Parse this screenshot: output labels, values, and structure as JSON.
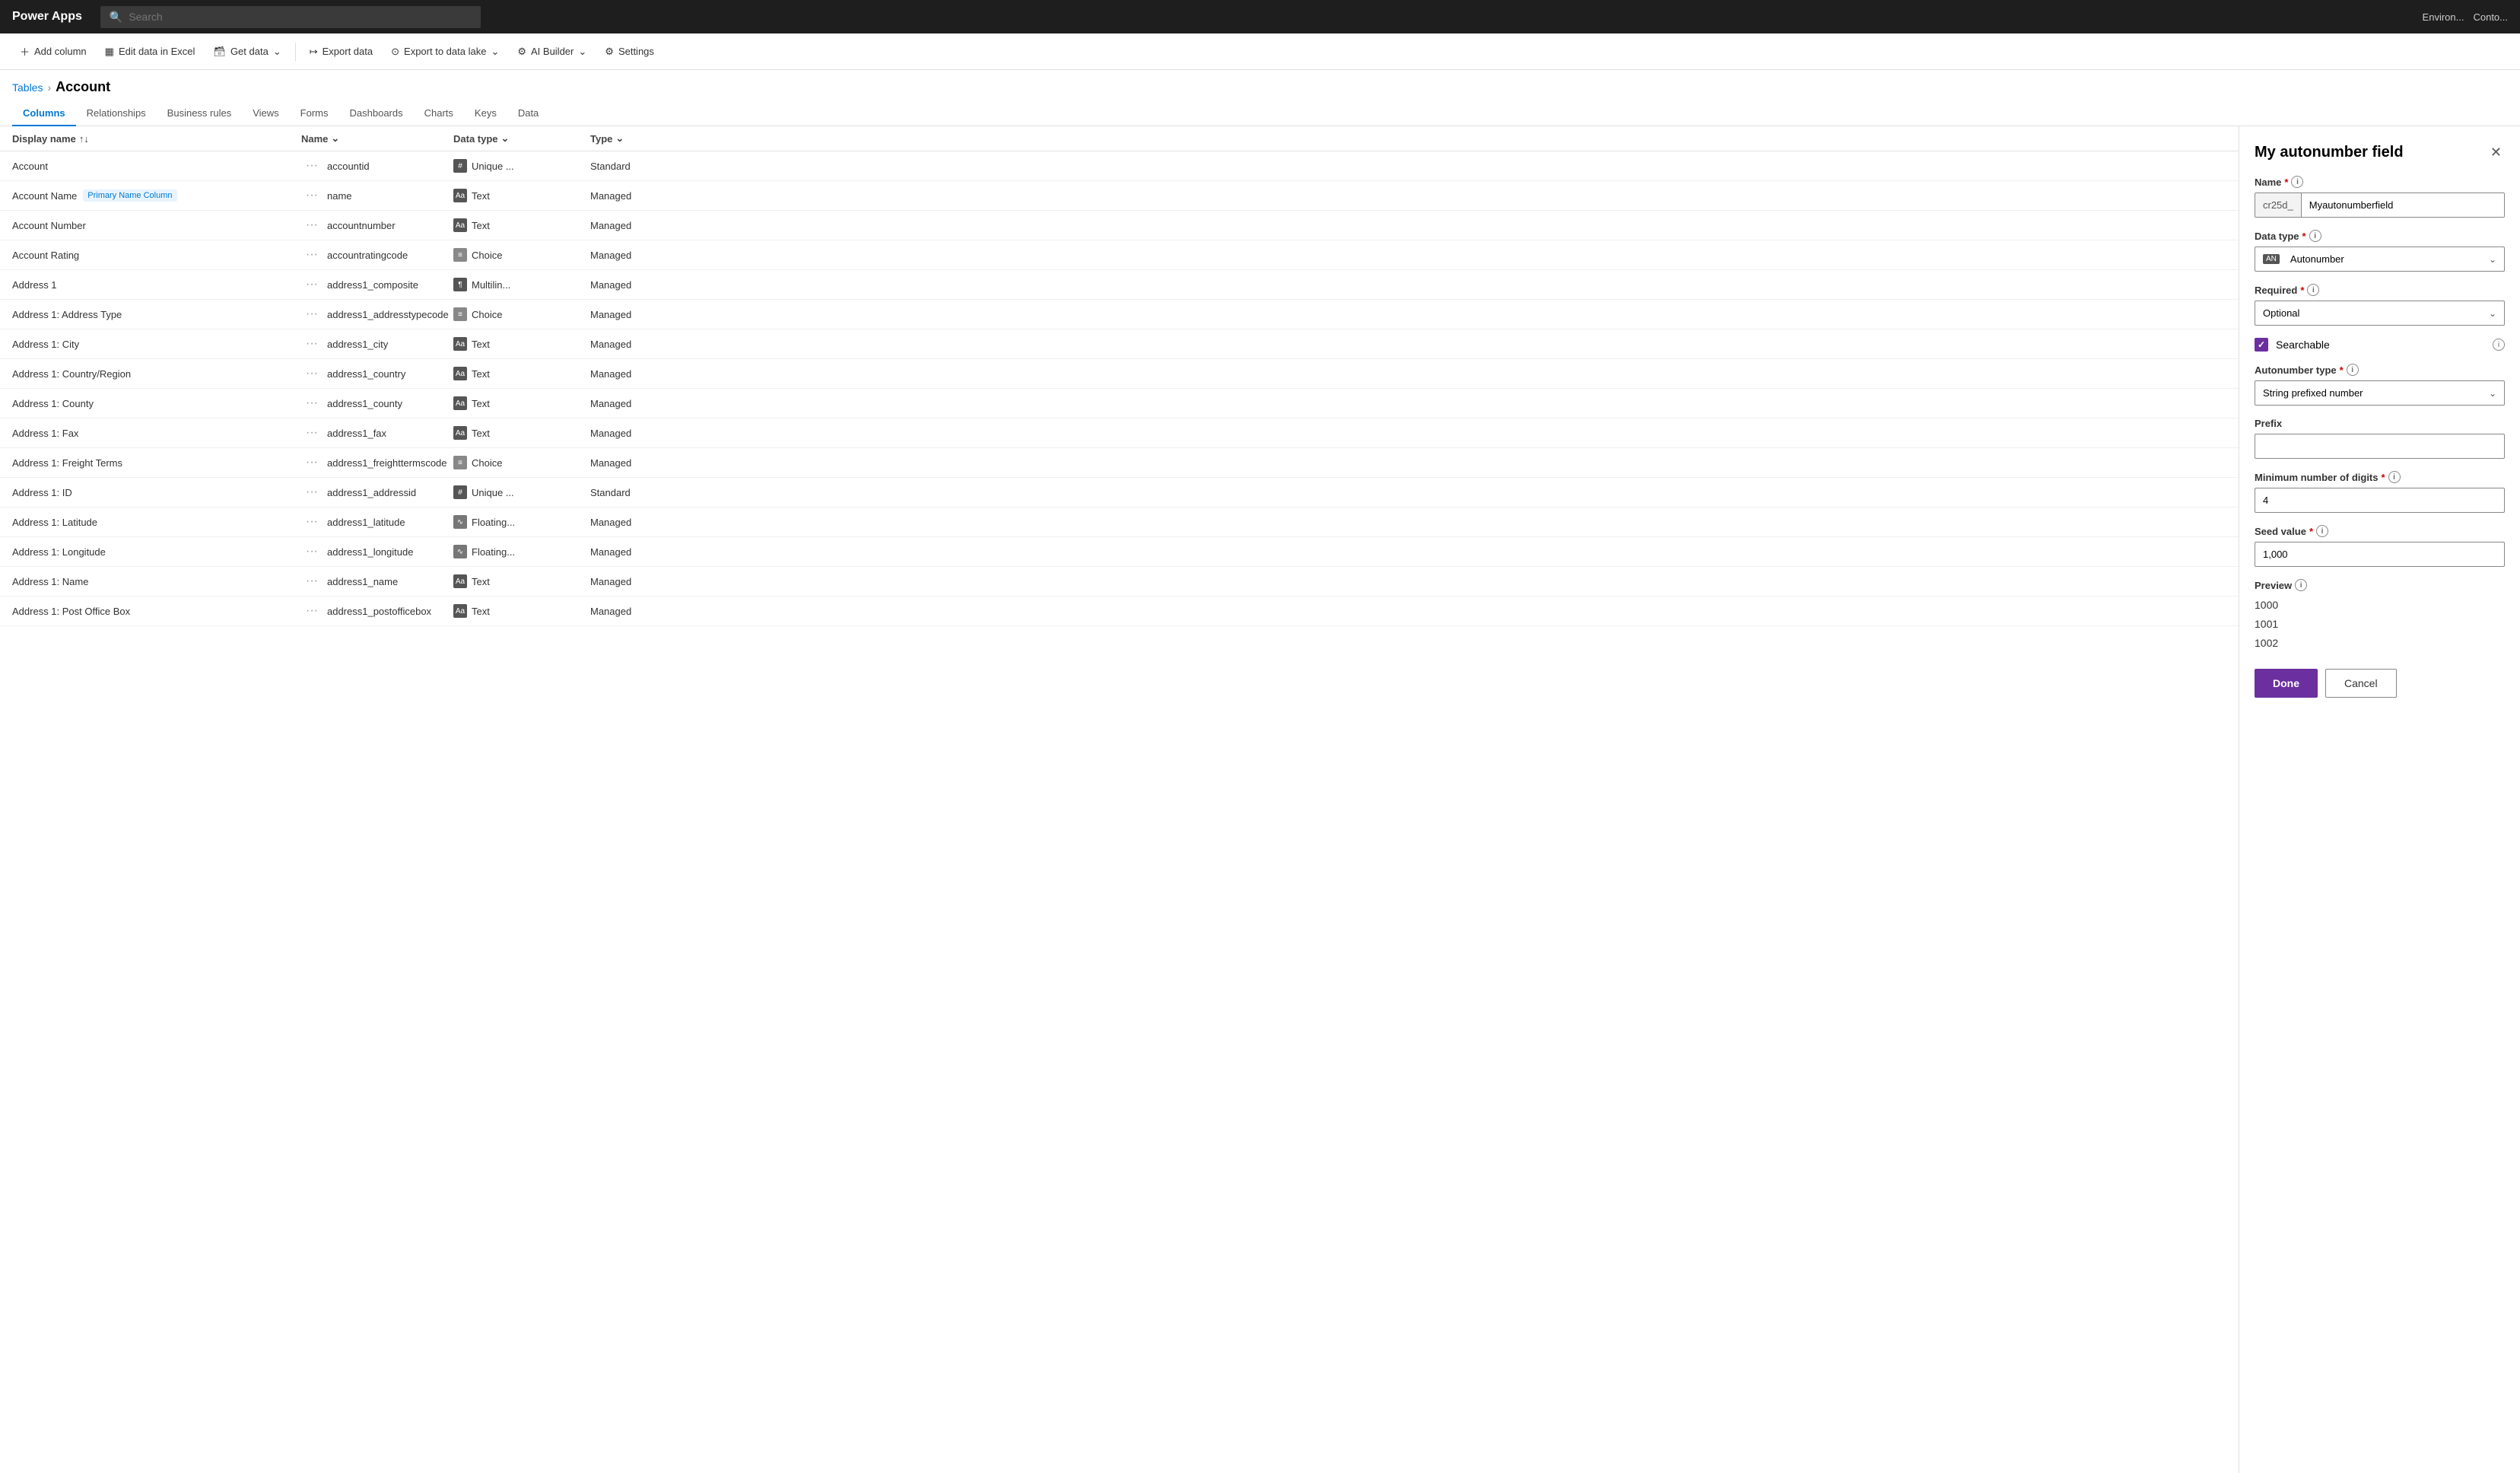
{
  "app": {
    "logo": "Power Apps",
    "search_placeholder": "Search"
  },
  "topbar": {
    "env_label": "Environ...",
    "env_sub": "Conto..."
  },
  "toolbar": {
    "add_column": "Add column",
    "edit_excel": "Edit data in Excel",
    "get_data": "Get data",
    "export_data": "Export data",
    "export_lake": "Export to data lake",
    "ai_builder": "AI Builder",
    "settings": "Settings"
  },
  "breadcrumb": {
    "tables": "Tables",
    "separator": "›",
    "current": "Account"
  },
  "tabs": [
    {
      "id": "columns",
      "label": "Columns",
      "active": true
    },
    {
      "id": "relationships",
      "label": "Relationships"
    },
    {
      "id": "business-rules",
      "label": "Business rules"
    },
    {
      "id": "views",
      "label": "Views"
    },
    {
      "id": "forms",
      "label": "Forms"
    },
    {
      "id": "dashboards",
      "label": "Dashboards"
    },
    {
      "id": "charts",
      "label": "Charts"
    },
    {
      "id": "keys",
      "label": "Keys"
    },
    {
      "id": "data",
      "label": "Data"
    }
  ],
  "table": {
    "headers": {
      "display_name": "Display name",
      "name": "Name",
      "data_type": "Data type",
      "type": "Type"
    },
    "rows": [
      {
        "display_name": "Account",
        "name": "accountid",
        "data_type": "Unique ...",
        "type": "Standard",
        "dt_icon": "unique"
      },
      {
        "display_name": "Account Name",
        "badge": "Primary Name Column",
        "name": "name",
        "data_type": "Text",
        "type": "Managed",
        "dt_icon": "text"
      },
      {
        "display_name": "Account Number",
        "name": "accountnumber",
        "data_type": "Text",
        "type": "Managed",
        "dt_icon": "text"
      },
      {
        "display_name": "Account Rating",
        "name": "accountratingcode",
        "data_type": "Choice",
        "type": "Managed",
        "dt_icon": "choice"
      },
      {
        "display_name": "Address 1",
        "name": "address1_composite",
        "data_type": "Multilin...",
        "type": "Managed",
        "dt_icon": "multiline"
      },
      {
        "display_name": "Address 1: Address Type",
        "name": "address1_addresstypecode",
        "data_type": "Choice",
        "type": "Managed",
        "dt_icon": "choice"
      },
      {
        "display_name": "Address 1: City",
        "name": "address1_city",
        "data_type": "Text",
        "type": "Managed",
        "dt_icon": "text"
      },
      {
        "display_name": "Address 1: Country/Region",
        "name": "address1_country",
        "data_type": "Text",
        "type": "Managed",
        "dt_icon": "text"
      },
      {
        "display_name": "Address 1: County",
        "name": "address1_county",
        "data_type": "Text",
        "type": "Managed",
        "dt_icon": "text"
      },
      {
        "display_name": "Address 1: Fax",
        "name": "address1_fax",
        "data_type": "Text",
        "type": "Managed",
        "dt_icon": "text"
      },
      {
        "display_name": "Address 1: Freight Terms",
        "name": "address1_freighttermscode",
        "data_type": "Choice",
        "type": "Managed",
        "dt_icon": "choice"
      },
      {
        "display_name": "Address 1: ID",
        "name": "address1_addressid",
        "data_type": "Unique ...",
        "type": "Standard",
        "dt_icon": "unique"
      },
      {
        "display_name": "Address 1: Latitude",
        "name": "address1_latitude",
        "data_type": "Floating...",
        "type": "Managed",
        "dt_icon": "float"
      },
      {
        "display_name": "Address 1: Longitude",
        "name": "address1_longitude",
        "data_type": "Floating...",
        "type": "Managed",
        "dt_icon": "float"
      },
      {
        "display_name": "Address 1: Name",
        "name": "address1_name",
        "data_type": "Text",
        "type": "Managed",
        "dt_icon": "text"
      },
      {
        "display_name": "Address 1: Post Office Box",
        "name": "address1_postofficebox",
        "data_type": "Text",
        "type": "Managed",
        "dt_icon": "text"
      }
    ]
  },
  "panel": {
    "title": "My autonumber field",
    "name_prefix": "cr25d_",
    "name_value": "Myautonumberfield",
    "data_type_label": "Data type",
    "data_type_value": "Autonumber",
    "required_label": "Required",
    "required_value": "Optional",
    "searchable_label": "Searchable",
    "searchable_checked": true,
    "autonumber_type_label": "Autonumber type",
    "autonumber_type_value": "String prefixed number",
    "prefix_label": "Prefix",
    "prefix_value": "",
    "min_digits_label": "Minimum number of digits",
    "min_digits_value": "4",
    "seed_label": "Seed value",
    "seed_value": "1,000",
    "preview_label": "Preview",
    "preview_values": [
      "1000",
      "1001",
      "1002"
    ],
    "done_label": "Done",
    "cancel_label": "Cancel"
  }
}
